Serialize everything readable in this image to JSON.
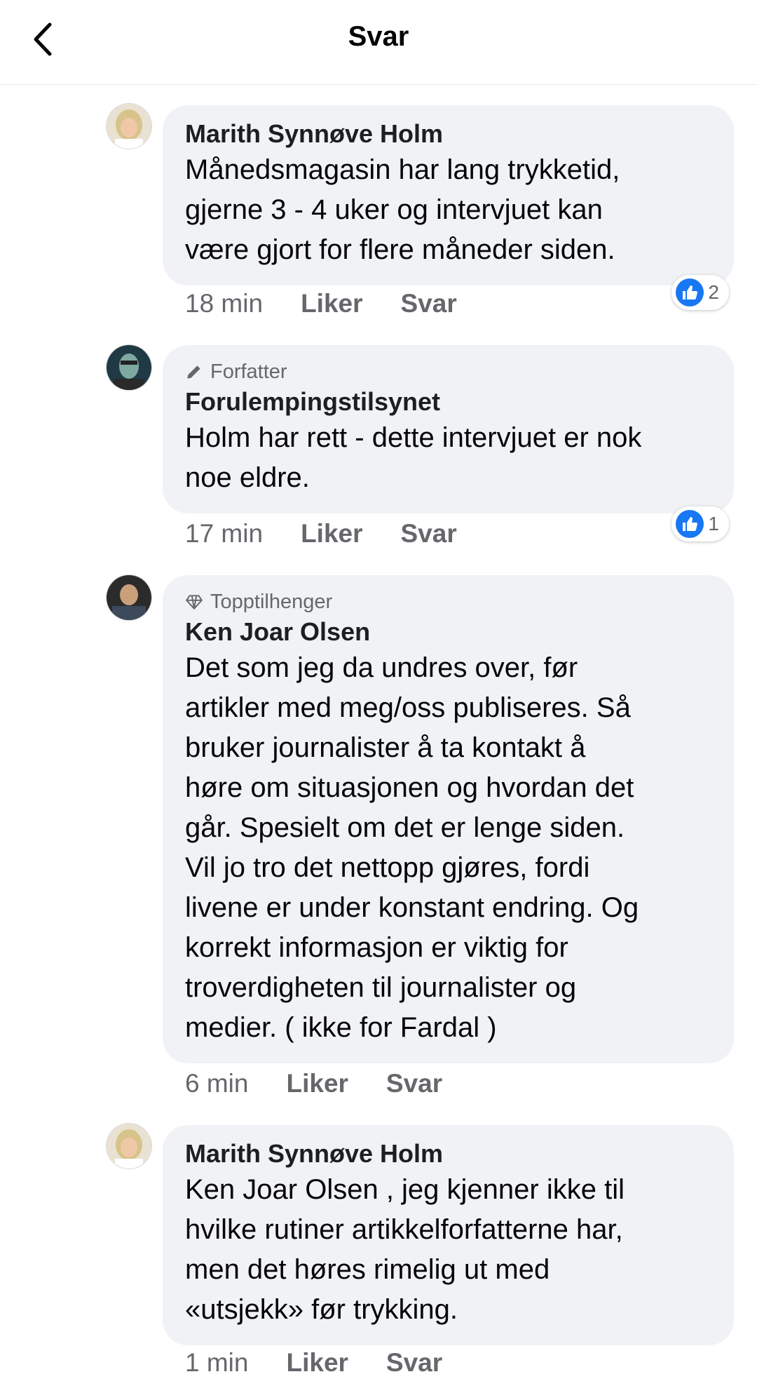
{
  "header": {
    "title": "Svar"
  },
  "comments": [
    {
      "author": "Marith Synnøve Holm",
      "badge": "",
      "lines": [
        "Månedsmagasin har lang trykketid,",
        "gjerne 3 - 4 uker og intervjuet kan",
        "være gjort for flere måneder siden."
      ],
      "time": "18 min",
      "like": "Liker",
      "reply": "Svar",
      "reactions": "2"
    },
    {
      "author": "Forulempingstilsynet",
      "badge": "Forfatter",
      "lines": [
        "Holm har rett - dette intervjuet er nok",
        "noe eldre."
      ],
      "time": "17 min",
      "like": "Liker",
      "reply": "Svar",
      "reactions": "1"
    },
    {
      "author": "Ken Joar Olsen",
      "badge": "Topptilhenger",
      "lines": [
        "Det som jeg da undres over, før",
        "artikler med meg/oss publiseres. Så",
        "bruker journalister å ta kontakt å",
        "høre om situasjonen og hvordan det",
        "går. Spesielt om det er lenge siden.",
        "Vil jo tro det nettopp gjøres, fordi",
        "livene er under konstant endring. Og",
        "korrekt informasjon er viktig for",
        "troverdigheten til journalister og",
        "medier. ( ikke for Fardal )"
      ],
      "time": "6 min",
      "like": "Liker",
      "reply": "Svar"
    },
    {
      "author": "Marith Synnøve Holm",
      "badge": "",
      "lines": [
        "Ken Joar Olsen , jeg kjenner ikke til",
        "hvilke rutiner artikkelforfatterne har,",
        "men det høres rimelig ut med",
        "«utsjekk» før trykking."
      ],
      "time": "1 min",
      "like": "Liker",
      "reply": "Svar"
    }
  ],
  "icons": {
    "back": "chevron-left-icon",
    "author_badge": "pencil-icon",
    "fan_badge": "diamond-icon",
    "reaction": "like-icon"
  },
  "colors": {
    "bubble": "#f0f2f5",
    "like_blue": "#1877f2",
    "meta_gray": "#65676b"
  }
}
